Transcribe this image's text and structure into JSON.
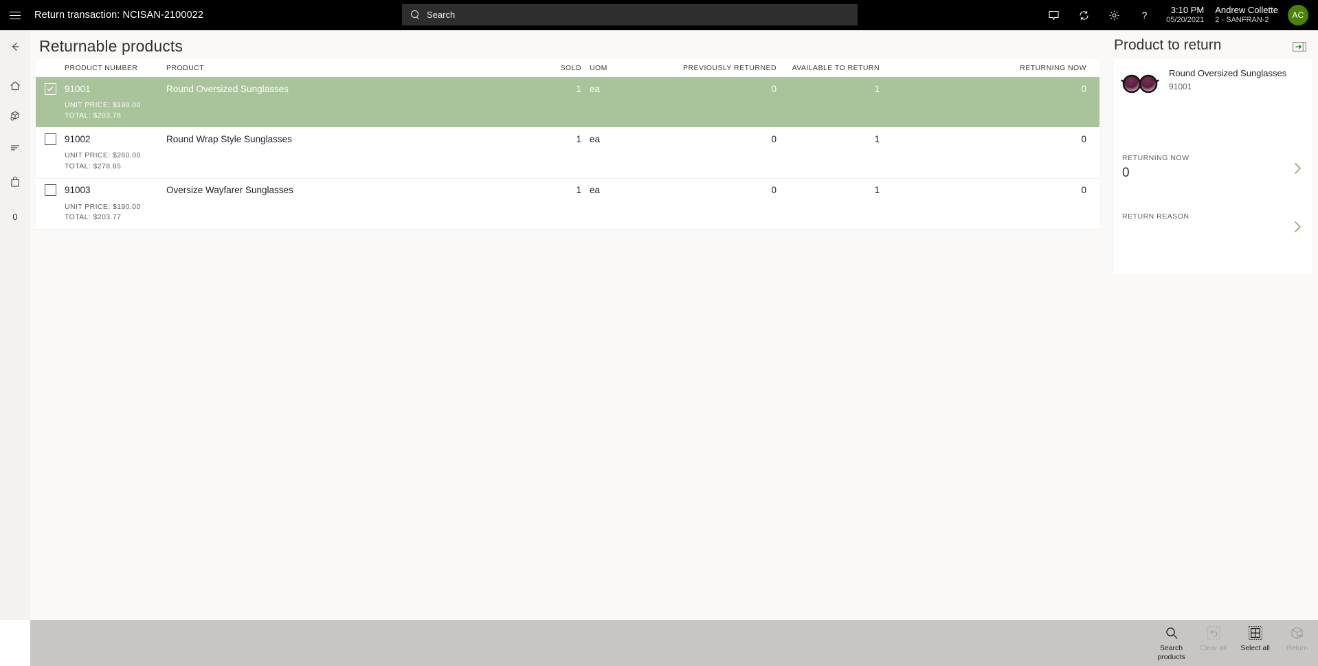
{
  "topbar": {
    "menu_icon": "hamburger-icon",
    "title": "Return transaction: NCISAN-2100022",
    "search_placeholder": "Search",
    "icons": [
      "feedback-icon",
      "sync-icon",
      "settings-gear-icon",
      "help-question-icon"
    ],
    "time": "3:10 PM",
    "date": "05/20/2021",
    "user_name": "Andrew Collette",
    "user_store": "2 - SANFRAN-2",
    "avatar_initials": "AC",
    "avatar_color": "#498205"
  },
  "rail": {
    "items": [
      {
        "name": "back-arrow-icon",
        "label": ""
      },
      {
        "name": "home-icon",
        "label": ""
      },
      {
        "name": "products-cube-icon",
        "label": ""
      },
      {
        "name": "list-lines-icon",
        "label": ""
      },
      {
        "name": "shopping-bag-icon",
        "label": ""
      },
      {
        "name": "cart-count",
        "label": "0"
      }
    ]
  },
  "main": {
    "page_title": "Returnable products",
    "columns": {
      "product_number": "PRODUCT NUMBER",
      "product": "PRODUCT",
      "sold": "SOLD",
      "uom": "UOM",
      "previously_returned": "PREVIOUSLY RETURNED",
      "available_to_return": "AVAILABLE TO RETURN",
      "returning_now": "RETURNING NOW"
    },
    "selected_row_color": "#a9c39a",
    "rows": [
      {
        "selected": true,
        "product_number": "91001",
        "product": "Round Oversized Sunglasses",
        "sold": "1",
        "uom": "ea",
        "previously_returned": "0",
        "available_to_return": "1",
        "returning_now": "0",
        "unit_price": "UNIT PRICE: $190.00",
        "total": "TOTAL: $203.78"
      },
      {
        "selected": false,
        "product_number": "91002",
        "product": "Round Wrap Style Sunglasses",
        "sold": "1",
        "uom": "ea",
        "previously_returned": "0",
        "available_to_return": "1",
        "returning_now": "0",
        "unit_price": "UNIT PRICE: $260.00",
        "total": "TOTAL: $278.85"
      },
      {
        "selected": false,
        "product_number": "91003",
        "product": "Oversize Wayfarer Sunglasses",
        "sold": "1",
        "uom": "ea",
        "previously_returned": "0",
        "available_to_return": "1",
        "returning_now": "0",
        "unit_price": "UNIT PRICE: $190.00",
        "total": "TOTAL: $203.77"
      }
    ]
  },
  "right_panel": {
    "title": "Product to return",
    "expand_icon": "expand-panel-icon",
    "product_image": "sunglasses-thumbnail",
    "product_name": "Round Oversized Sunglasses",
    "product_number": "91001",
    "returning_now_label": "RETURNING NOW",
    "returning_now_value": "0",
    "return_reason_label": "RETURN REASON",
    "return_reason_value": ""
  },
  "bottom_toolbar": {
    "buttons": [
      {
        "label": "Search products",
        "icon": "magnifier-icon",
        "disabled": false
      },
      {
        "label": "Clear all",
        "icon": "clear-undo-icon",
        "disabled": true
      },
      {
        "label": "Select all",
        "icon": "select-all-grid-icon",
        "disabled": false
      },
      {
        "label": "Return",
        "icon": "return-box-icon",
        "disabled": true
      }
    ]
  }
}
